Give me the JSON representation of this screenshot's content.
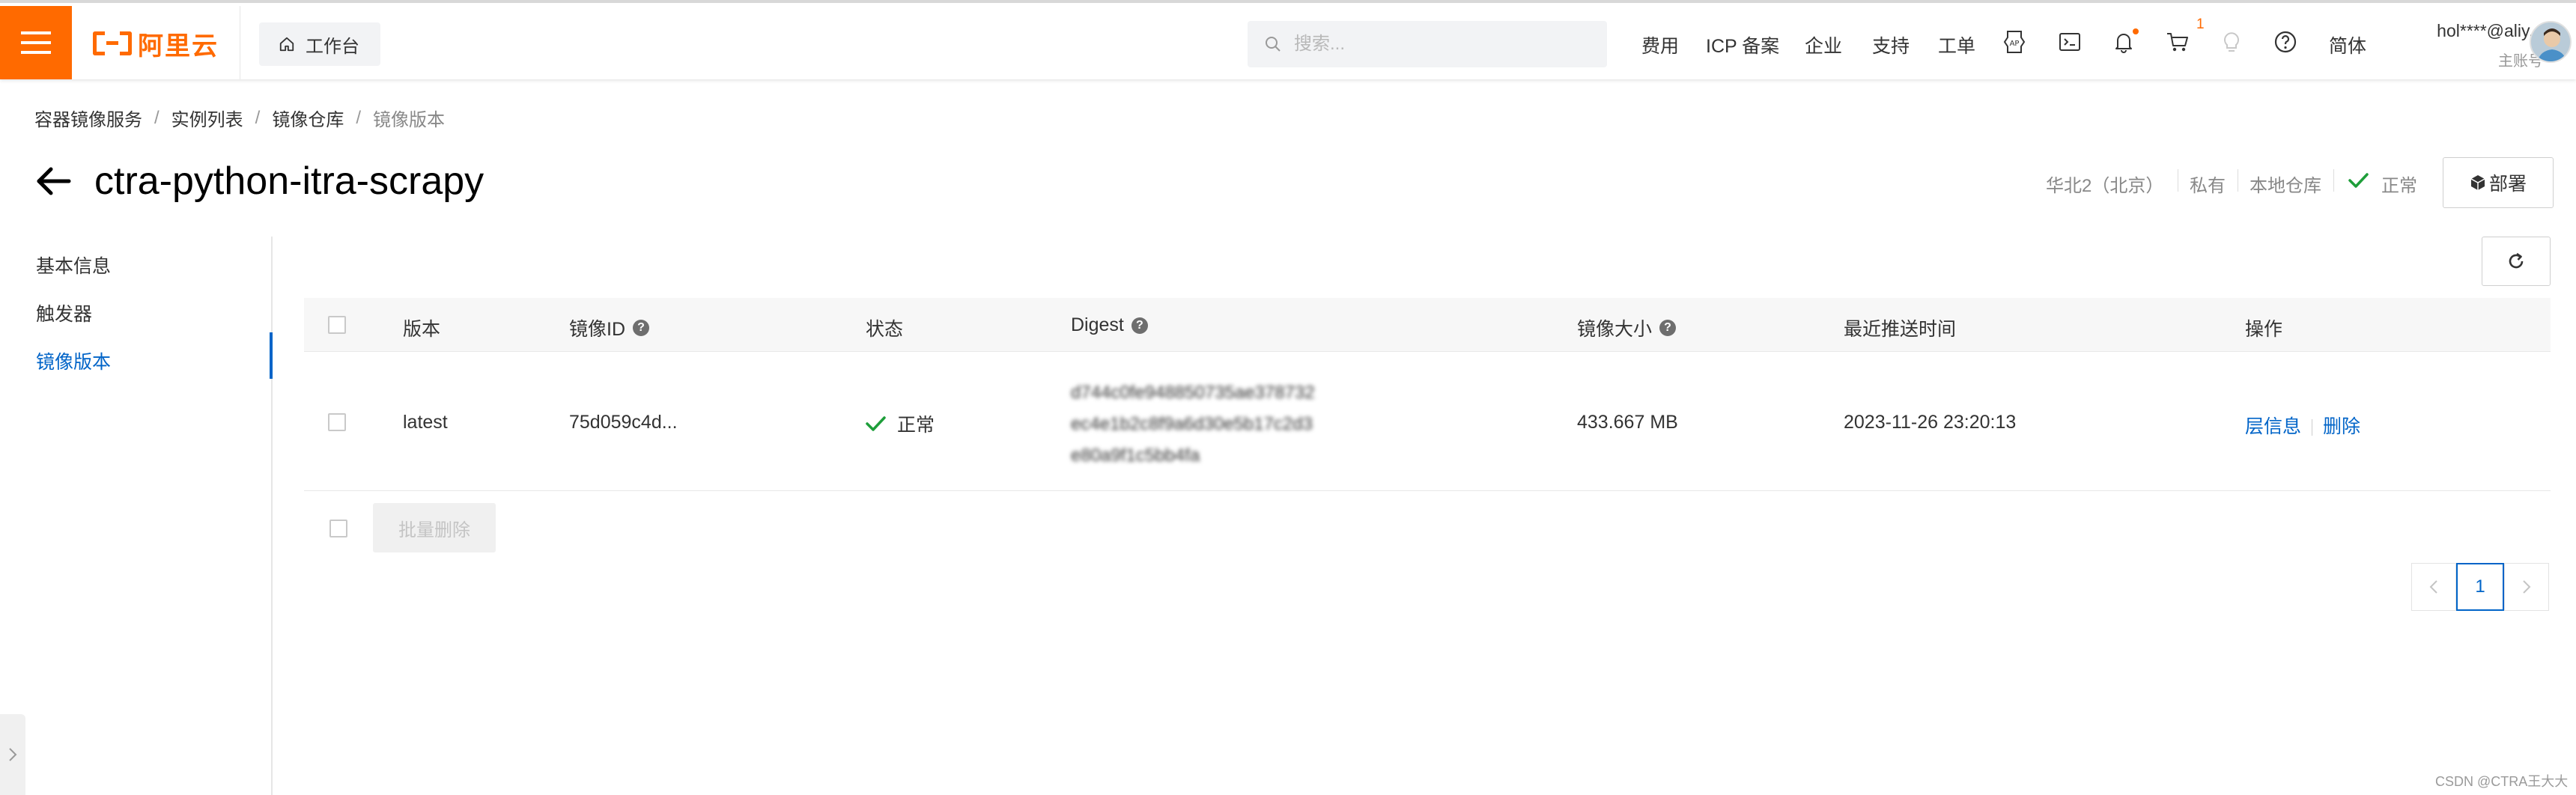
{
  "topbar": {
    "logo_text": "阿里云",
    "workbench_label": "工作台",
    "search_placeholder": "搜索...",
    "nav": {
      "fees": "费用",
      "icp": "ICP 备案",
      "enterprise": "企业",
      "support": "支持",
      "ticket": "工单",
      "language": "简体"
    },
    "cart_count": "1",
    "user_name": "hol****@aliy...",
    "user_role": "主账号",
    "accent_color": "#ff6a00"
  },
  "breadcrumb": [
    "容器镜像服务",
    "实例列表",
    "镜像仓库",
    "镜像版本"
  ],
  "header": {
    "title": "ctra-python-itra-scrapy",
    "region": "华北2（北京）",
    "visibility": "私有",
    "repo_type": "本地仓库",
    "status": "正常",
    "deploy_label": "部署"
  },
  "sidebar": {
    "items": [
      {
        "label": "基本信息",
        "active": false
      },
      {
        "label": "触发器",
        "active": false
      },
      {
        "label": "镜像版本",
        "active": true
      }
    ],
    "active_color": "#0064c8"
  },
  "table": {
    "columns": [
      "版本",
      "镜像ID",
      "状态",
      "Digest",
      "镜像大小",
      "最近推送时间",
      "操作"
    ],
    "rows": [
      {
        "version": "latest",
        "image_id": "75d059c4d...",
        "status": "正常",
        "digest": "d744c0fe948850735ae378732ec4e1b2c8f9a6d30e5b17c2d3e80a9f1c5bb4fa",
        "size": "433.667 MB",
        "pushed": "2023-11-26 23:20:13",
        "actions": [
          "层信息",
          "删除"
        ]
      }
    ],
    "batch_delete_label": "批量删除",
    "current_page": "1"
  },
  "footer": {
    "watermark": "CSDN @CTRA王大大"
  }
}
